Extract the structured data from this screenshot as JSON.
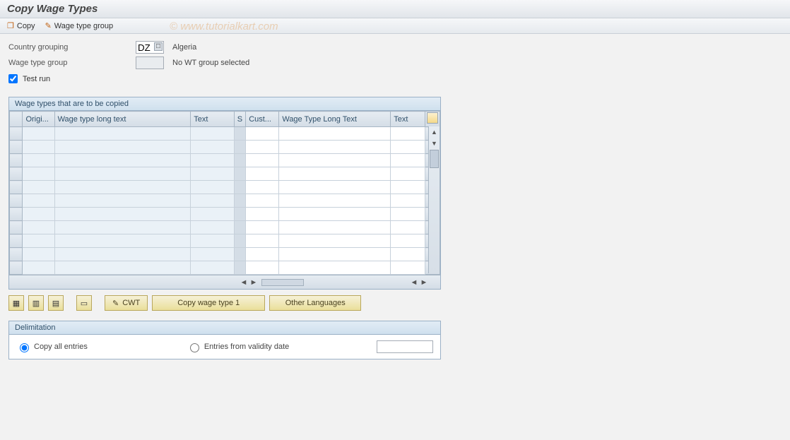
{
  "title": "Copy Wage Types",
  "toolbar": {
    "copy_label": "Copy",
    "wage_type_group_label": "Wage type group"
  },
  "watermark": "© www.tutorialkart.com",
  "form": {
    "country_grouping_label": "Country grouping",
    "country_grouping_value": "DZ",
    "country_grouping_text": "Algeria",
    "wage_type_group_label": "Wage type group",
    "wage_type_group_value": "",
    "wage_type_group_text": "No WT group selected",
    "test_run_label": "Test run",
    "test_run_checked": true
  },
  "grid": {
    "caption": "Wage types that are to be copied",
    "columns": {
      "original": "Origi...",
      "wt_long_text_orig": "Wage type long text",
      "text_orig": "Text",
      "s": "S",
      "customer": "Cust...",
      "wt_long_text_cust": "Wage Type Long Text",
      "text_cust": "Text"
    },
    "row_count": 11
  },
  "buttons": {
    "cwt_label": "CWT",
    "copy_wt1_label": "Copy wage type 1",
    "other_lang_label": "Other Languages"
  },
  "delimitation": {
    "caption": "Delimitation",
    "opt_all_label": "Copy all entries",
    "opt_from_label": "Entries from validity date",
    "date_value": ""
  }
}
